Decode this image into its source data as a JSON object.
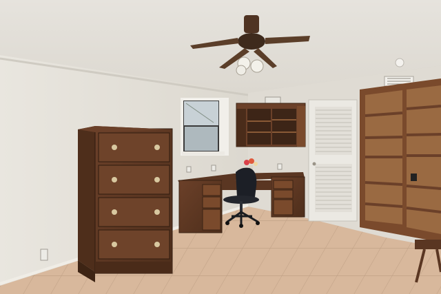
{
  "scene": {
    "subject": "interior-room-photo",
    "colors": {
      "ceiling": "#e4e1db",
      "wall_left": "#e2ded6",
      "wall_right": "#dedad2",
      "floor_tile": "#d8b89c",
      "grout": "#bfa085",
      "wood_dark": "#5a3622",
      "wood_mid": "#7a4a2c",
      "wood_light": "#9a6a42",
      "brass": "#d8c8a0",
      "fan_blade": "#5b3e29",
      "door": "#eceae4",
      "window_glass": "#b9c3c9",
      "chair": "#1c1f26"
    }
  }
}
